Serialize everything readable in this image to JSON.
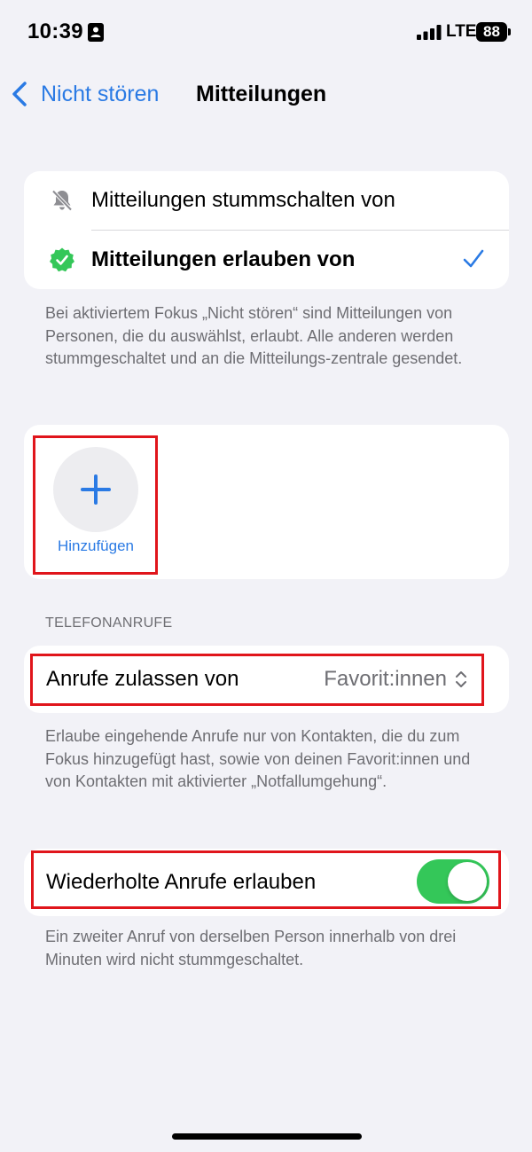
{
  "status_bar": {
    "time": "10:39",
    "network": "LTE",
    "battery": "88"
  },
  "nav": {
    "back_label": "Nicht stören",
    "title": "Mitteilungen"
  },
  "notifications_mode": {
    "options": [
      {
        "label": "Mitteilungen stummschalten von",
        "icon": "bell-slash-icon",
        "selected": false
      },
      {
        "label": "Mitteilungen erlauben von",
        "icon": "checkmark-seal-icon",
        "selected": true
      }
    ],
    "footnote": "Bei aktiviertem Fokus „Nicht stören“ sind Mitteilungen von Personen, die du auswählst, erlaubt. Alle anderen werden stummgeschaltet und an die Mitteilungs-zentrale gesendet."
  },
  "people": {
    "add_label": "Hinzufügen"
  },
  "phone_calls": {
    "section_header": "TELEFONANRUFE",
    "allow_calls_label": "Anrufe zulassen von",
    "allow_calls_value": "Favorit:innen",
    "allow_calls_footnote": "Erlaube eingehende Anrufe nur von Kontakten, die du zum Fokus hinzugefügt hast, sowie von deinen Favorit:innen und von Kontakten mit aktivierter „Notfallumgehung“.",
    "repeated_calls_label": "Wiederholte Anrufe erlauben",
    "repeated_calls_enabled": true,
    "repeated_calls_footnote": "Ein zweiter Anruf von derselben Person innerhalb von drei Minuten wird nicht stummgeschaltet."
  },
  "colors": {
    "accent": "#2a7ae4",
    "toggle_on": "#34c759",
    "highlight": "#e0151b",
    "seal": "#34c759"
  }
}
